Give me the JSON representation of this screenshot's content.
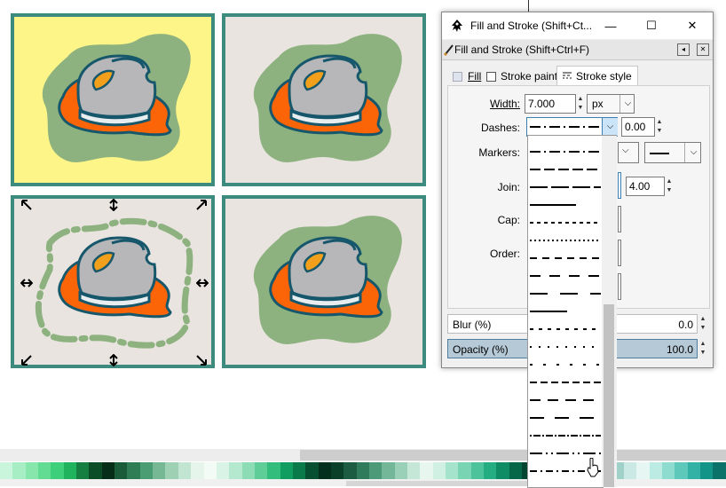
{
  "canvas": {
    "tiles": [
      {
        "name": "tile-top-left",
        "background": "#fdf587"
      },
      {
        "name": "tile-top-right",
        "background": "#e9e4e0"
      },
      {
        "name": "tile-bottom-left",
        "background": "#e9e4e0",
        "selected": true
      },
      {
        "name": "tile-bottom-right",
        "background": "#e9e4e0"
      }
    ],
    "colors": {
      "tile_border": "#3d8b7f",
      "blob": "#8db27f",
      "flame": "#fc6408",
      "helmet": "#b7b7ba",
      "outline": "#16576b",
      "leaf": "#f29f1b"
    }
  },
  "palette": [
    "#c8f5dc",
    "#a7eec4",
    "#86e6ac",
    "#62db93",
    "#3ecf7a",
    "#1fb35d",
    "#157f42",
    "#0a4d27",
    "#062d17",
    "#1a5c3a",
    "#2f7d55",
    "#4a9c72",
    "#76b894",
    "#9ed0b4",
    "#c2e5d1",
    "#e5f5ec",
    "#f2fbf6",
    "#d9f4e6",
    "#b5e9cf",
    "#8cdcb5",
    "#5fcd98",
    "#33bd7c",
    "#129d60",
    "#0b7a4a",
    "#064f31",
    "#03301e",
    "#0a3f2a",
    "#1b5c42",
    "#2f7b5b",
    "#4d9a79",
    "#73b698",
    "#9bd0b8",
    "#c4e7d8",
    "#e7f7f0",
    "#d0f0e4",
    "#a6e3cd",
    "#79d4b4",
    "#4cc39a",
    "#23ad80",
    "#0f8c64",
    "#066748",
    "#034530",
    "#02281c",
    "#0b3b2d",
    "#1b5847",
    "#307865",
    "#4c9887",
    "#74b6a9",
    "#9fd1c8",
    "#cbe9e4",
    "#e6f6f3",
    "#bcebe3",
    "#8edbd0",
    "#5ec8bb",
    "#32b2a4",
    "#129588",
    "#0a7268"
  ],
  "dialog": {
    "window_title": "Fill and Stroke (Shift+Ct...",
    "panel_title": "Fill and Stroke (Shift+Ctrl+F)",
    "window_buttons": {
      "minimize": "—",
      "maximize": "☐",
      "close": "✕"
    },
    "panel_buttons": {
      "pin": "◂",
      "close": "✕"
    },
    "tabs": [
      {
        "label": "Fill",
        "active": false
      },
      {
        "label": "Stroke paint",
        "active": false
      },
      {
        "label": "Stroke style",
        "active": true
      }
    ],
    "width": {
      "label": "Width:",
      "value": "7.000",
      "unit": "px"
    },
    "dashes": {
      "label": "Dashes:",
      "offset": "0.00"
    },
    "markers": {
      "label": "Markers:"
    },
    "join": {
      "label": "Join:",
      "miter": "4.00"
    },
    "cap": {
      "label": "Cap:"
    },
    "order": {
      "label": "Order:"
    },
    "blur": {
      "label": "Blur (%)",
      "value": "0.0"
    },
    "opacity": {
      "label": "Opacity (%)",
      "value": "100.0"
    }
  },
  "dash_patterns": [
    [
      12,
      4,
      2,
      4
    ],
    [
      12,
      4
    ],
    [
      20,
      4
    ],
    [
      40,
      0
    ],
    [
      4,
      4
    ],
    [
      2,
      3
    ],
    [
      8,
      6
    ],
    [
      12,
      10
    ],
    [
      20,
      14
    ],
    [
      30,
      0
    ],
    [
      4,
      6
    ],
    [
      2,
      8
    ],
    [
      3,
      12
    ],
    [
      8,
      4
    ],
    [
      12,
      8
    ],
    [
      16,
      12
    ],
    [
      2,
      2,
      8,
      2
    ],
    [
      14,
      4,
      2,
      4,
      2,
      4
    ],
    [
      8,
      4,
      2,
      4
    ]
  ]
}
